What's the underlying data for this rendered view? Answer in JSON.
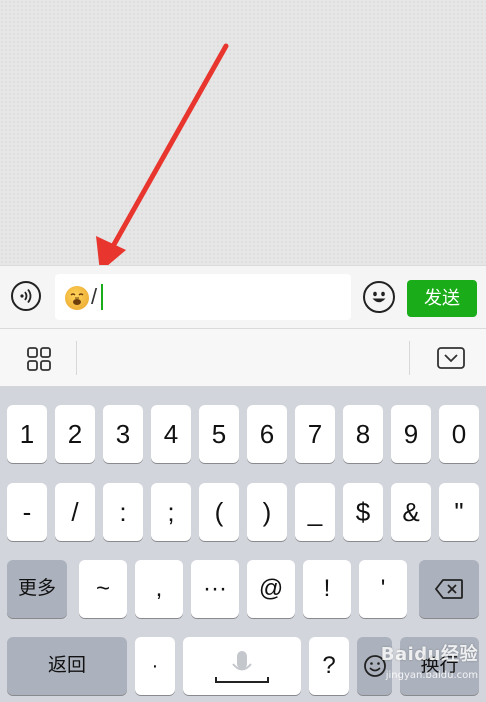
{
  "input_bar": {
    "typed_text": "/",
    "send_label": "发送"
  },
  "icons": {
    "voice": "voice-icon",
    "emoji": "smiley-icon",
    "apps": "apps-grid-icon",
    "collapse": "keyboard-collapse-icon",
    "mic": "microphone-icon",
    "backspace": "backspace-icon",
    "arrow": "red-arrow-annotation"
  },
  "colors": {
    "send_button": "#1aad19",
    "caret": "#1aad19",
    "annotation_arrow": "#e8362e"
  },
  "keyboard": {
    "row1": [
      "1",
      "2",
      "3",
      "4",
      "5",
      "6",
      "7",
      "8",
      "9",
      "0"
    ],
    "row2": [
      "-",
      "/",
      ":",
      ";",
      "(",
      ")",
      "_",
      "$",
      "&",
      "\""
    ],
    "row3": [
      "~",
      ",",
      "···",
      "@",
      "!",
      "'"
    ],
    "more_label": "更多",
    "back_label": "返回",
    "dot_label": "·",
    "question_label": "?",
    "newline_label": "换行"
  },
  "watermark": {
    "logo": "Baidu经验",
    "url": "jingyan.baidu.com"
  }
}
